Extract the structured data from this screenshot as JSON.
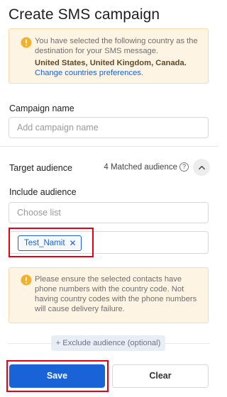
{
  "page": {
    "title": "Create SMS campaign"
  },
  "country_notice": {
    "icon": "warning-icon",
    "text": "You have selected the following country as the destination for your SMS message.",
    "countries": "United States, United Kingdom, Canada.",
    "link": "Change countries preferences."
  },
  "campaign_name": {
    "label": "Campaign name",
    "placeholder": "Add campaign name"
  },
  "target_audience": {
    "label": "Target audience",
    "matched": "4 Matched audience",
    "help_icon": "help-icon",
    "toggle_icon": "chevron-up-icon"
  },
  "include_audience": {
    "label": "Include audience",
    "placeholder": "Choose list",
    "chips": [
      {
        "label": "Test_Namit",
        "remove_icon": "close-icon"
      }
    ]
  },
  "phone_notice": {
    "icon": "warning-icon",
    "text": "Please ensure the selected contacts have phone numbers with the country code. Not having country codes with the phone numbers will cause delivery failure."
  },
  "exclude": {
    "label": "+ Exclude audience (optional)"
  },
  "actions": {
    "save": "Save",
    "clear": "Clear"
  },
  "colors": {
    "accent": "#1a63d6",
    "notice_bg": "#fdf4e4",
    "warning": "#f2b12b",
    "highlight": "#e40018"
  }
}
